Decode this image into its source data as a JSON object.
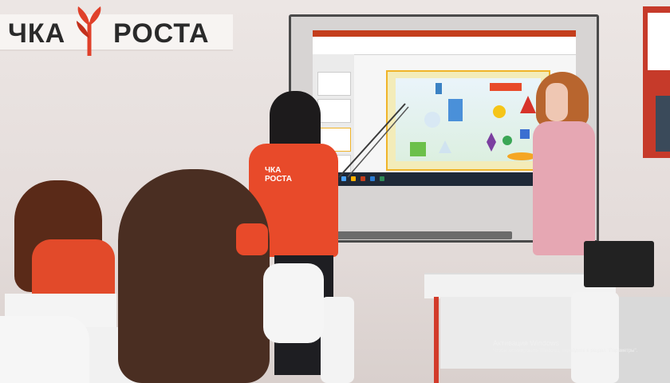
{
  "wall_sign": {
    "text_left": "ЧКА",
    "text_right": "РОСТА",
    "logo_color": "#e0402a"
  },
  "tshirt_print": "ЧКА РОСТА",
  "watermark": {
    "title": "Активация Windows",
    "text": "Чтобы активировать Windows, перейдите в раздел \"Параметры\"."
  },
  "colors": {
    "wall": "#ece6e4",
    "tshirt": "#e84a2a",
    "board_frame": "#4a4a4a",
    "slide_border": "#f0b429",
    "ppt_accent": "#c43e1c"
  }
}
